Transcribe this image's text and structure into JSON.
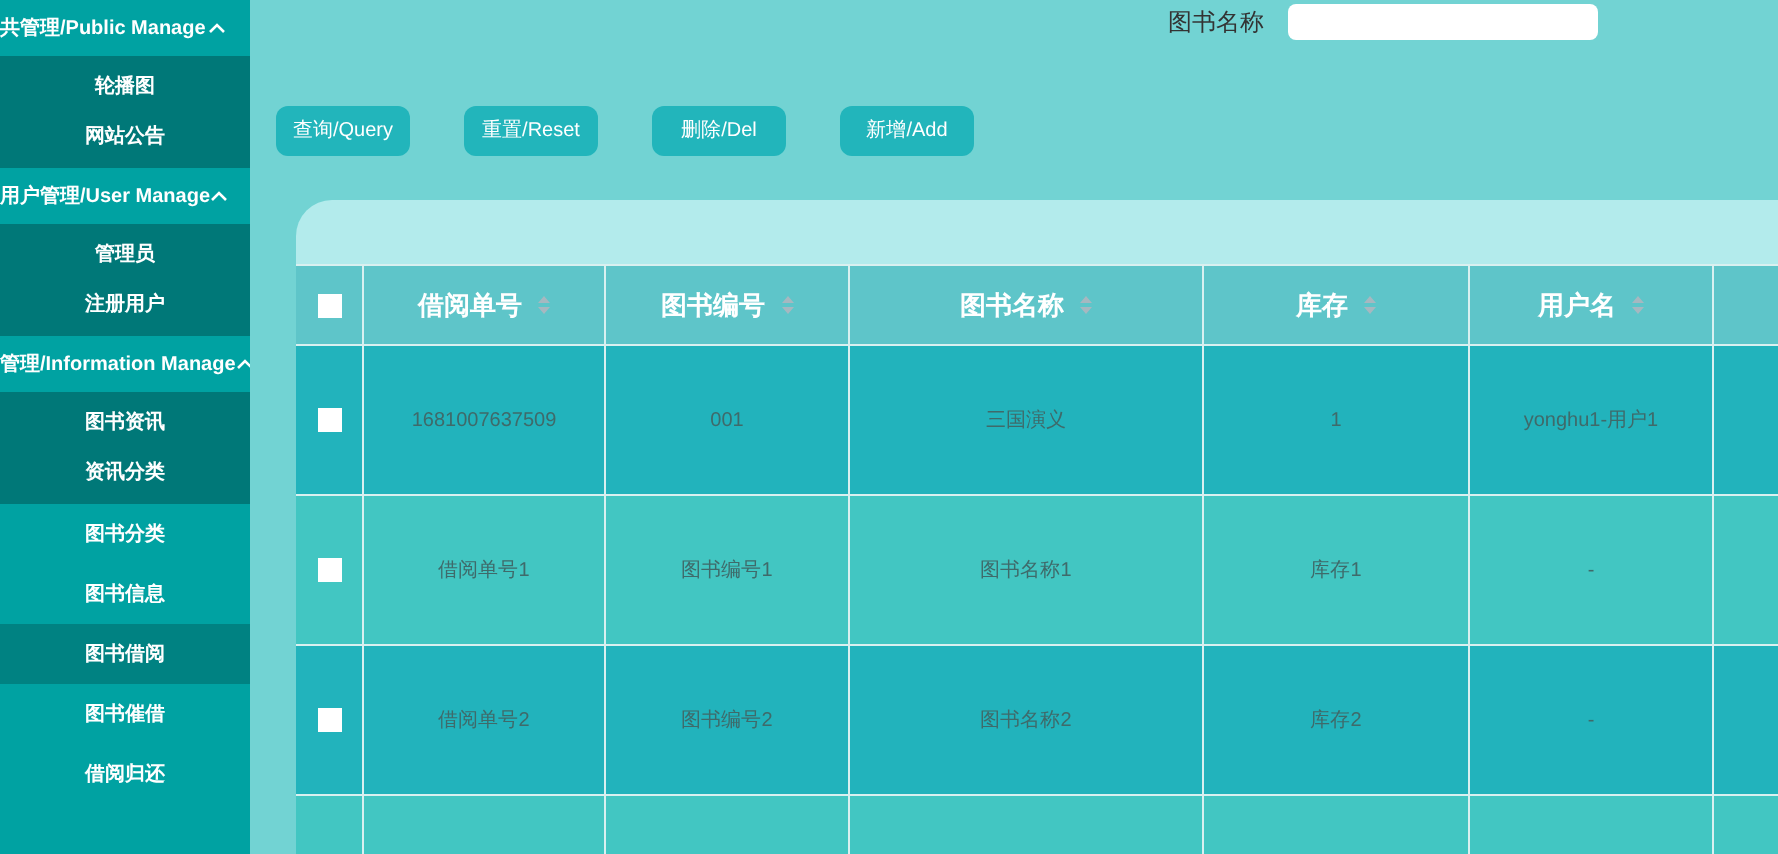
{
  "sidebar": {
    "entries": [
      {
        "kind": "group",
        "label": "共管理/Public Manage",
        "expanded": true,
        "items": [
          {
            "label": "轮播图",
            "selected": false
          },
          {
            "label": "网站公告",
            "selected": false
          }
        ]
      },
      {
        "kind": "group",
        "label": "用户管理/User Manage",
        "expanded": true,
        "items": [
          {
            "label": "管理员",
            "selected": false
          },
          {
            "label": "注册用户",
            "selected": false
          }
        ]
      },
      {
        "kind": "group",
        "label": "管理/Information Manage",
        "expanded": true,
        "items": [
          {
            "label": "图书资讯",
            "selected": false
          },
          {
            "label": "资讯分类",
            "selected": false
          }
        ]
      },
      {
        "kind": "item",
        "label": "图书分类",
        "selected": false
      },
      {
        "kind": "item",
        "label": "图书信息",
        "selected": false
      },
      {
        "kind": "item",
        "label": "图书借阅",
        "selected": true
      },
      {
        "kind": "item",
        "label": "图书催借",
        "selected": false
      },
      {
        "kind": "item",
        "label": "借阅归还",
        "selected": false
      }
    ]
  },
  "search": {
    "label": "图书名称"
  },
  "buttons": [
    "查询/Query",
    "重置/Reset",
    "删除/Del",
    "新增/Add"
  ],
  "table": {
    "select_all": {
      "checked": false
    },
    "columns": [
      "借阅单号",
      "图书编号",
      "图书名称",
      "库存",
      "用户名"
    ],
    "rows": [
      {
        "checked": false,
        "cells": [
          "1681007637509",
          "001",
          "三国演义",
          "1",
          "yonghu1-用户1"
        ]
      },
      {
        "checked": false,
        "cells": [
          "借阅单号1",
          "图书编号1",
          "图书名称1",
          "库存1",
          "-"
        ]
      },
      {
        "checked": false,
        "cells": [
          "借阅单号2",
          "图书编号2",
          "图书名称2",
          "库存2",
          "-"
        ]
      }
    ]
  }
}
